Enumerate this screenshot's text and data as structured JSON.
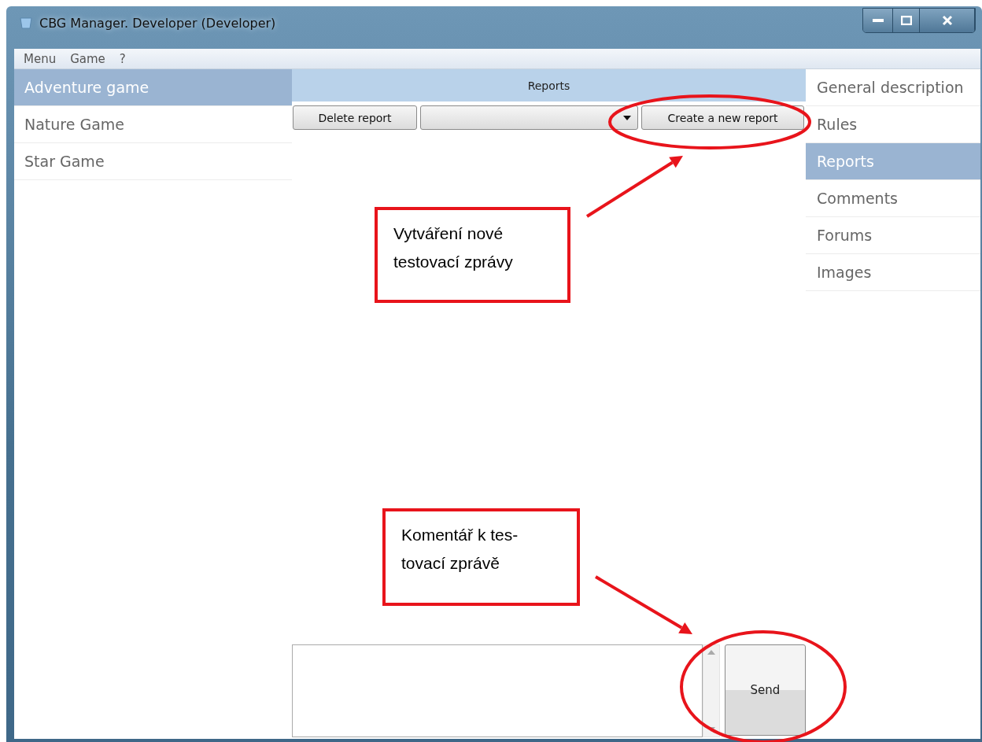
{
  "window": {
    "title": "CBG Manager.  Developer (Developer)"
  },
  "menu": [
    "Menu",
    "Game",
    "?"
  ],
  "games": [
    {
      "label": "Adventure game",
      "selected": true
    },
    {
      "label": "Nature Game",
      "selected": false
    },
    {
      "label": "Star Game",
      "selected": false
    }
  ],
  "reports": {
    "header": "Reports",
    "delete_button": "Delete report",
    "create_button": "Create a new report",
    "send_button": "Send"
  },
  "sections": [
    {
      "label": "General description",
      "selected": false
    },
    {
      "label": "Rules",
      "selected": false
    },
    {
      "label": "Reports",
      "selected": true
    },
    {
      "label": "Comments",
      "selected": false
    },
    {
      "label": "Forums",
      "selected": false
    },
    {
      "label": "Images",
      "selected": false
    }
  ],
  "annotations": [
    {
      "kind": "callout",
      "text": "Vytváření nové\ntestovací zprávy"
    },
    {
      "kind": "callout",
      "text": "Komentář k tes-\ntovací zprávě"
    },
    {
      "kind": "ellipse"
    },
    {
      "kind": "ellipse"
    },
    {
      "kind": "arrow"
    },
    {
      "kind": "arrow"
    }
  ]
}
